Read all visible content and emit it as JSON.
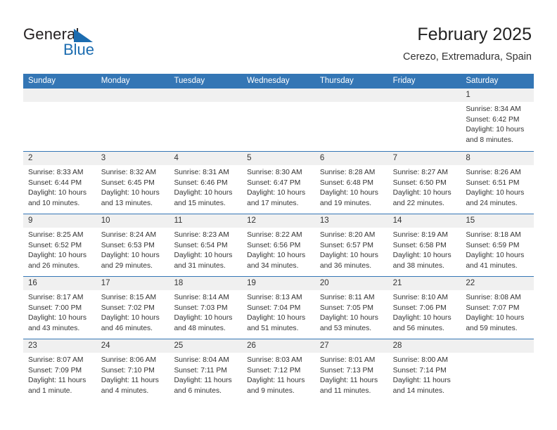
{
  "logo": {
    "word1": "General",
    "word2": "Blue",
    "triangle_color": "#1b6cb0"
  },
  "header": {
    "title": "February 2025",
    "subtitle": "Cerezo, Extremadura, Spain",
    "accent_color": "#3476b5"
  },
  "weekdays": [
    "Sunday",
    "Monday",
    "Tuesday",
    "Wednesday",
    "Thursday",
    "Friday",
    "Saturday"
  ],
  "labels": {
    "sunrise": "Sunrise:",
    "sunset": "Sunset:",
    "daylight": "Daylight:"
  },
  "weeks": [
    [
      {
        "day": "",
        "empty": true
      },
      {
        "day": "",
        "empty": true
      },
      {
        "day": "",
        "empty": true
      },
      {
        "day": "",
        "empty": true
      },
      {
        "day": "",
        "empty": true
      },
      {
        "day": "",
        "empty": true
      },
      {
        "day": "1",
        "sunrise": "Sunrise: 8:34 AM",
        "sunset": "Sunset: 6:42 PM",
        "daylight": "Daylight: 10 hours and 8 minutes."
      }
    ],
    [
      {
        "day": "2",
        "sunrise": "Sunrise: 8:33 AM",
        "sunset": "Sunset: 6:44 PM",
        "daylight": "Daylight: 10 hours and 10 minutes."
      },
      {
        "day": "3",
        "sunrise": "Sunrise: 8:32 AM",
        "sunset": "Sunset: 6:45 PM",
        "daylight": "Daylight: 10 hours and 13 minutes."
      },
      {
        "day": "4",
        "sunrise": "Sunrise: 8:31 AM",
        "sunset": "Sunset: 6:46 PM",
        "daylight": "Daylight: 10 hours and 15 minutes."
      },
      {
        "day": "5",
        "sunrise": "Sunrise: 8:30 AM",
        "sunset": "Sunset: 6:47 PM",
        "daylight": "Daylight: 10 hours and 17 minutes."
      },
      {
        "day": "6",
        "sunrise": "Sunrise: 8:28 AM",
        "sunset": "Sunset: 6:48 PM",
        "daylight": "Daylight: 10 hours and 19 minutes."
      },
      {
        "day": "7",
        "sunrise": "Sunrise: 8:27 AM",
        "sunset": "Sunset: 6:50 PM",
        "daylight": "Daylight: 10 hours and 22 minutes."
      },
      {
        "day": "8",
        "sunrise": "Sunrise: 8:26 AM",
        "sunset": "Sunset: 6:51 PM",
        "daylight": "Daylight: 10 hours and 24 minutes."
      }
    ],
    [
      {
        "day": "9",
        "sunrise": "Sunrise: 8:25 AM",
        "sunset": "Sunset: 6:52 PM",
        "daylight": "Daylight: 10 hours and 26 minutes."
      },
      {
        "day": "10",
        "sunrise": "Sunrise: 8:24 AM",
        "sunset": "Sunset: 6:53 PM",
        "daylight": "Daylight: 10 hours and 29 minutes."
      },
      {
        "day": "11",
        "sunrise": "Sunrise: 8:23 AM",
        "sunset": "Sunset: 6:54 PM",
        "daylight": "Daylight: 10 hours and 31 minutes."
      },
      {
        "day": "12",
        "sunrise": "Sunrise: 8:22 AM",
        "sunset": "Sunset: 6:56 PM",
        "daylight": "Daylight: 10 hours and 34 minutes."
      },
      {
        "day": "13",
        "sunrise": "Sunrise: 8:20 AM",
        "sunset": "Sunset: 6:57 PM",
        "daylight": "Daylight: 10 hours and 36 minutes."
      },
      {
        "day": "14",
        "sunrise": "Sunrise: 8:19 AM",
        "sunset": "Sunset: 6:58 PM",
        "daylight": "Daylight: 10 hours and 38 minutes."
      },
      {
        "day": "15",
        "sunrise": "Sunrise: 8:18 AM",
        "sunset": "Sunset: 6:59 PM",
        "daylight": "Daylight: 10 hours and 41 minutes."
      }
    ],
    [
      {
        "day": "16",
        "sunrise": "Sunrise: 8:17 AM",
        "sunset": "Sunset: 7:00 PM",
        "daylight": "Daylight: 10 hours and 43 minutes."
      },
      {
        "day": "17",
        "sunrise": "Sunrise: 8:15 AM",
        "sunset": "Sunset: 7:02 PM",
        "daylight": "Daylight: 10 hours and 46 minutes."
      },
      {
        "day": "18",
        "sunrise": "Sunrise: 8:14 AM",
        "sunset": "Sunset: 7:03 PM",
        "daylight": "Daylight: 10 hours and 48 minutes."
      },
      {
        "day": "19",
        "sunrise": "Sunrise: 8:13 AM",
        "sunset": "Sunset: 7:04 PM",
        "daylight": "Daylight: 10 hours and 51 minutes."
      },
      {
        "day": "20",
        "sunrise": "Sunrise: 8:11 AM",
        "sunset": "Sunset: 7:05 PM",
        "daylight": "Daylight: 10 hours and 53 minutes."
      },
      {
        "day": "21",
        "sunrise": "Sunrise: 8:10 AM",
        "sunset": "Sunset: 7:06 PM",
        "daylight": "Daylight: 10 hours and 56 minutes."
      },
      {
        "day": "22",
        "sunrise": "Sunrise: 8:08 AM",
        "sunset": "Sunset: 7:07 PM",
        "daylight": "Daylight: 10 hours and 59 minutes."
      }
    ],
    [
      {
        "day": "23",
        "sunrise": "Sunrise: 8:07 AM",
        "sunset": "Sunset: 7:09 PM",
        "daylight": "Daylight: 11 hours and 1 minute."
      },
      {
        "day": "24",
        "sunrise": "Sunrise: 8:06 AM",
        "sunset": "Sunset: 7:10 PM",
        "daylight": "Daylight: 11 hours and 4 minutes."
      },
      {
        "day": "25",
        "sunrise": "Sunrise: 8:04 AM",
        "sunset": "Sunset: 7:11 PM",
        "daylight": "Daylight: 11 hours and 6 minutes."
      },
      {
        "day": "26",
        "sunrise": "Sunrise: 8:03 AM",
        "sunset": "Sunset: 7:12 PM",
        "daylight": "Daylight: 11 hours and 9 minutes."
      },
      {
        "day": "27",
        "sunrise": "Sunrise: 8:01 AM",
        "sunset": "Sunset: 7:13 PM",
        "daylight": "Daylight: 11 hours and 11 minutes."
      },
      {
        "day": "28",
        "sunrise": "Sunrise: 8:00 AM",
        "sunset": "Sunset: 7:14 PM",
        "daylight": "Daylight: 11 hours and 14 minutes."
      },
      {
        "day": "",
        "empty": true
      }
    ]
  ]
}
